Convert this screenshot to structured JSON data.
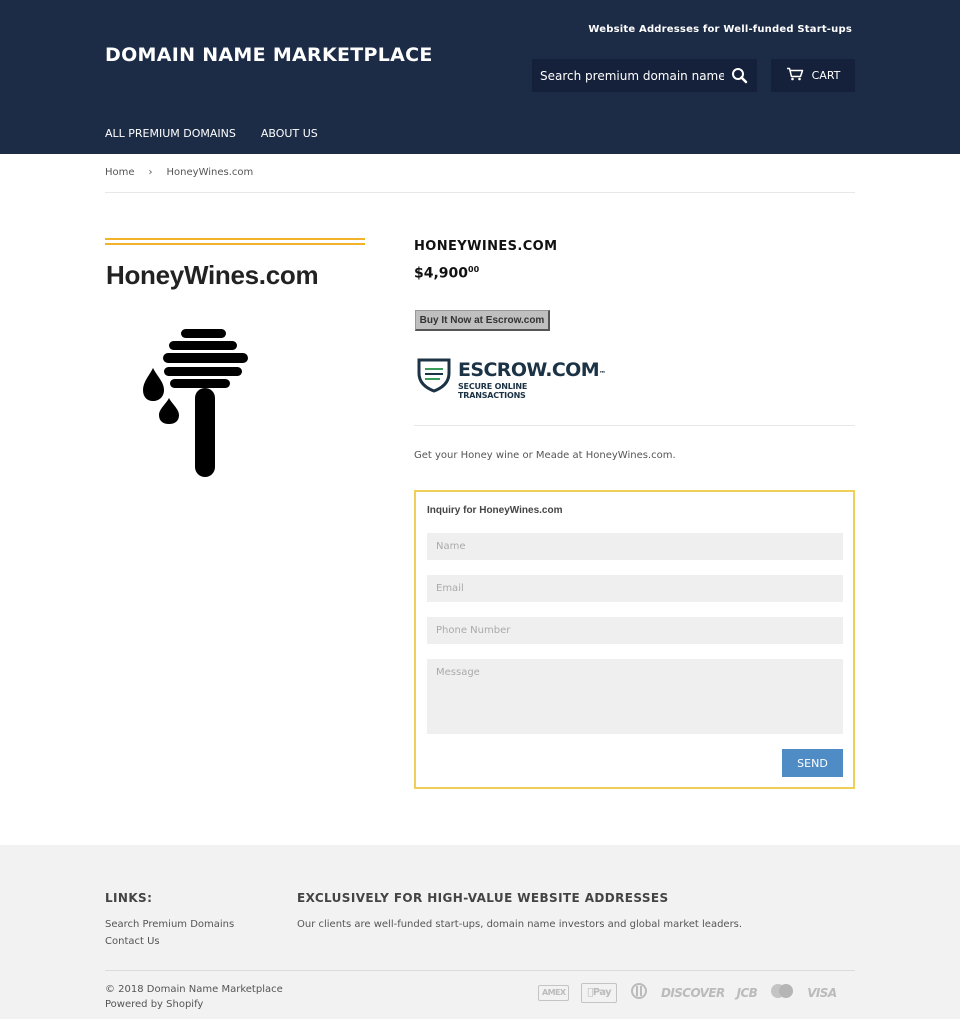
{
  "header": {
    "tagline": "Website Addresses for Well-funded Start-ups",
    "site_title": "DOMAIN NAME MARKETPLACE",
    "search_placeholder": "Search premium domain names",
    "cart_label": "CART",
    "nav": [
      "ALL PREMIUM DOMAINS",
      "ABOUT US"
    ],
    "background": "#1c2b46"
  },
  "breadcrumb": {
    "home": "Home",
    "separator": "›",
    "current": "HoneyWines.com"
  },
  "product": {
    "image_text": "HoneyWines.com",
    "title": "HONEYWINES.COM",
    "price_main": "$4,900",
    "price_cents": "00",
    "buy_button": "Buy It Now at Escrow.com",
    "escrow_logo_word": "ESCROW.COM",
    "escrow_logo_tm": "™",
    "escrow_logo_sub": "SECURE ONLINE TRANSACTIONS",
    "description": "Get your Honey wine or Meade at HoneyWines.com."
  },
  "inquiry": {
    "title": "Inquiry for HoneyWines.com",
    "name_placeholder": "Name",
    "email_placeholder": "Email",
    "phone_placeholder": "Phone Number",
    "message_placeholder": "Message",
    "send_label": "SEND",
    "border_color": "#f0cf58",
    "send_color": "#4f8bc5"
  },
  "footer": {
    "links_heading": "LINKS:",
    "links": [
      "Search Premium Domains",
      "Contact Us"
    ],
    "about_heading": "EXCLUSIVELY FOR HIGH-VALUE WEBSITE ADDRESSES",
    "about_text": "Our clients are well-funded start-ups, domain name investors and global market leaders.",
    "copyright": "© 2018 Domain Name Marketplace",
    "powered_by": "Powered by Shopify",
    "payment_icons": [
      "american-express-icon",
      "apple-pay-icon",
      "diners-club-icon",
      "discover-icon",
      "jcb-icon",
      "master-icon",
      "visa-icon"
    ],
    "payment_labels": [
      "AMEX",
      "Pay",
      "DISCOVER",
      "JCB",
      "VISA"
    ]
  }
}
